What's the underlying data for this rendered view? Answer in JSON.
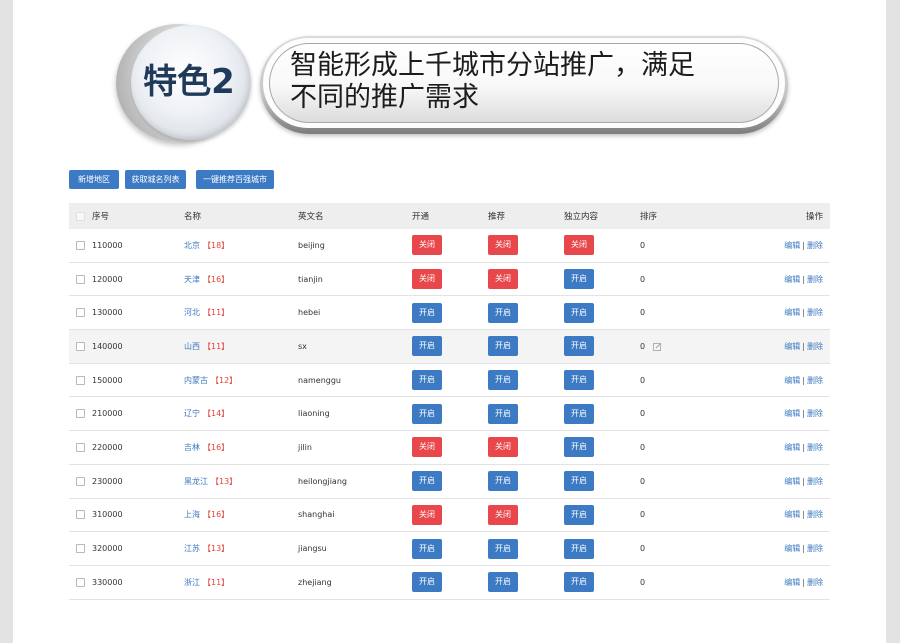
{
  "feature_badge": {
    "label": "特色2"
  },
  "banner": {
    "lines": [
      "智能形成上千城市分站推广，满足",
      "不同的推广需求"
    ]
  },
  "toolbar": {
    "add_region_label": "新增地区",
    "fetch_list_label": "获取城名列表",
    "recommend_top_label": "一键推荐百强城市"
  },
  "colors": {
    "primary": "#3c7bc4",
    "danger": "#e8474c",
    "link": "#3b78c2",
    "count": "#e0453c",
    "header_bg": "#eeeeee",
    "hover_bg": "#f4f4f4",
    "badge_text": "#1f3a5a"
  },
  "icons": {
    "sort_edit": "edit-icon"
  },
  "table": {
    "headers": {
      "code": "序号",
      "name": "名称",
      "en_name": "英文名",
      "open": "开通",
      "recommend": "推荐",
      "independent": "独立内容",
      "sort": "排序",
      "actions": "操作"
    },
    "status_labels": {
      "on": "开启",
      "off": "关闭"
    },
    "actions": {
      "edit": "编辑",
      "separator": "|",
      "delete": "删除"
    },
    "rows": [
      {
        "code": "110000",
        "name": "北京",
        "count": "【18】",
        "en_name": "beijing",
        "open": false,
        "recommend": false,
        "independent": false,
        "sort": "0"
      },
      {
        "code": "120000",
        "name": "天津",
        "count": "【16】",
        "en_name": "tianjin",
        "open": false,
        "recommend": false,
        "independent": true,
        "sort": "0"
      },
      {
        "code": "130000",
        "name": "河北",
        "count": "【11】",
        "en_name": "hebei",
        "open": true,
        "recommend": true,
        "independent": true,
        "sort": "0"
      },
      {
        "code": "140000",
        "name": "山西",
        "count": "【11】",
        "en_name": "sx",
        "open": true,
        "recommend": true,
        "independent": true,
        "sort": "0",
        "hovered": true
      },
      {
        "code": "150000",
        "name": "内蒙古",
        "count": "【12】",
        "en_name": "namenggu",
        "open": true,
        "recommend": true,
        "independent": true,
        "sort": "0"
      },
      {
        "code": "210000",
        "name": "辽宁",
        "count": "【14】",
        "en_name": "liaoning",
        "open": true,
        "recommend": true,
        "independent": true,
        "sort": "0"
      },
      {
        "code": "220000",
        "name": "吉林",
        "count": "【16】",
        "en_name": "jilin",
        "open": false,
        "recommend": false,
        "independent": true,
        "sort": "0"
      },
      {
        "code": "230000",
        "name": "黑龙江",
        "count": "【13】",
        "en_name": "heilongjiang",
        "open": true,
        "recommend": true,
        "independent": true,
        "sort": "0"
      },
      {
        "code": "310000",
        "name": "上海",
        "count": "【16】",
        "en_name": "shanghai",
        "open": false,
        "recommend": false,
        "independent": true,
        "sort": "0"
      },
      {
        "code": "320000",
        "name": "江苏",
        "count": "【13】",
        "en_name": "jiangsu",
        "open": true,
        "recommend": true,
        "independent": true,
        "sort": "0"
      },
      {
        "code": "330000",
        "name": "浙江",
        "count": "【11】",
        "en_name": "zhejiang",
        "open": true,
        "recommend": true,
        "independent": true,
        "sort": "0"
      }
    ]
  }
}
